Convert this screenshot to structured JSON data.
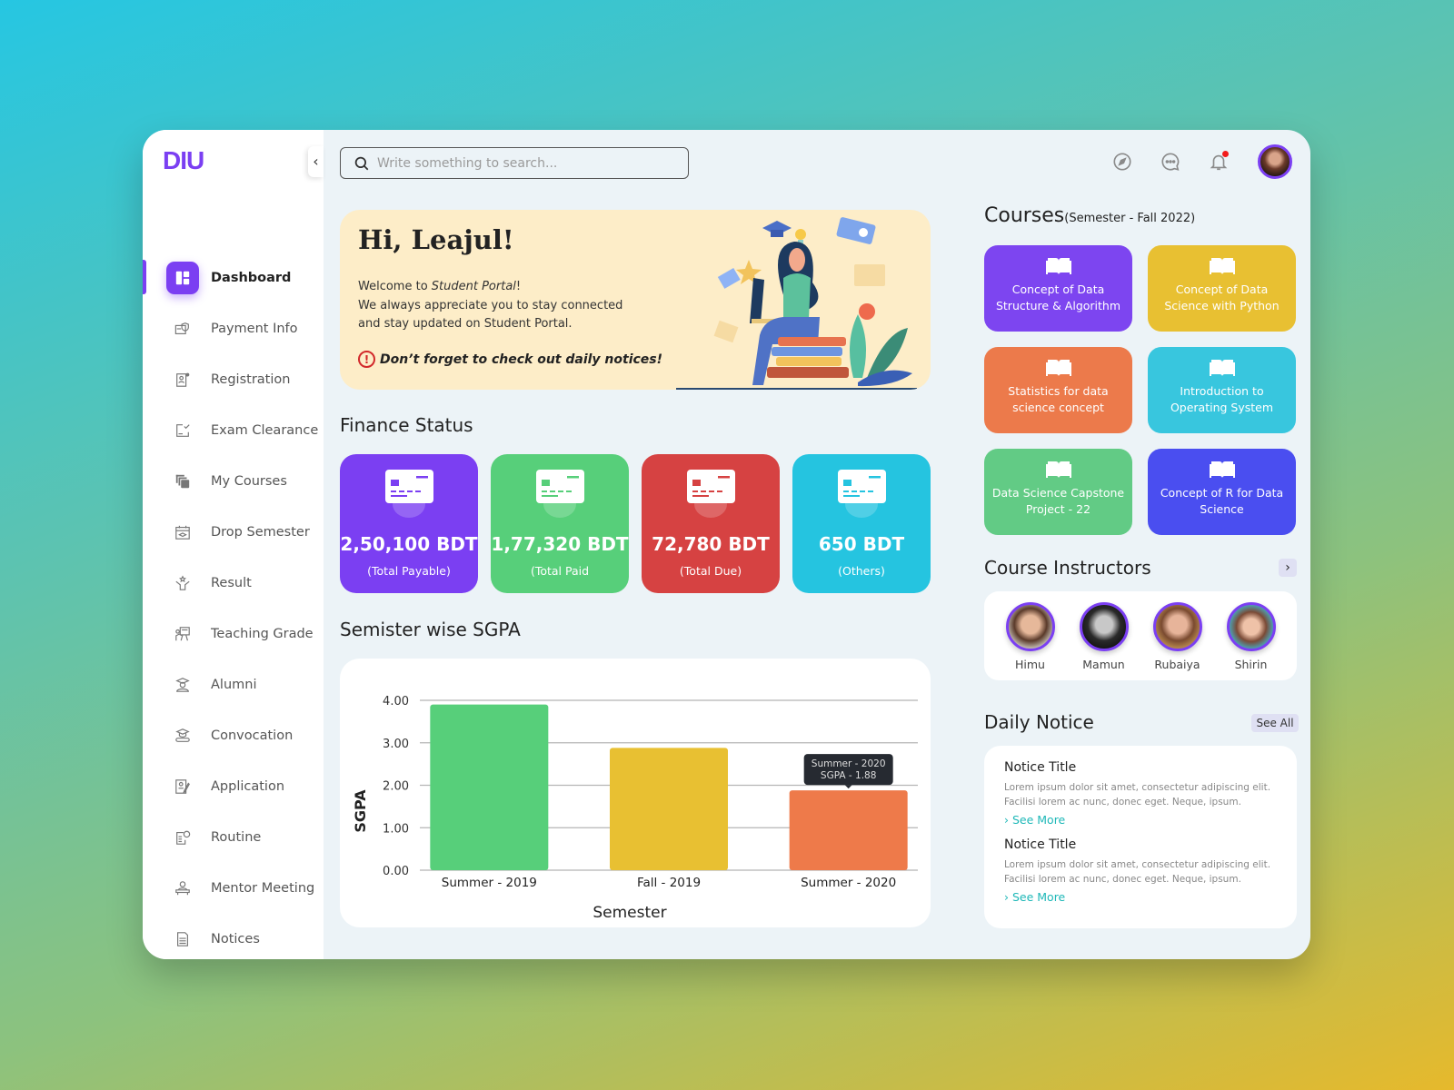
{
  "app": {
    "logo": "DIU",
    "collapse_icon": "‹"
  },
  "search": {
    "placeholder": "Write something to search..."
  },
  "topbar": {
    "icons": [
      "compass-icon",
      "chat-icon",
      "bell-icon"
    ],
    "has_notification": true
  },
  "sidebar": {
    "items": [
      {
        "label": "Dashboard",
        "icon": "dashboard-icon",
        "active": true
      },
      {
        "label": "Payment Info",
        "icon": "payment-icon"
      },
      {
        "label": "Registration",
        "icon": "registration-icon"
      },
      {
        "label": "Exam Clearance",
        "icon": "exam-clearance-icon"
      },
      {
        "label": "My Courses",
        "icon": "courses-icon"
      },
      {
        "label": "Drop Semester",
        "icon": "drop-semester-icon"
      },
      {
        "label": "Result",
        "icon": "result-icon"
      },
      {
        "label": "Teaching Grade",
        "icon": "teaching-grade-icon"
      },
      {
        "label": "Alumni",
        "icon": "alumni-icon"
      },
      {
        "label": "Convocation",
        "icon": "convocation-icon"
      },
      {
        "label": "Application",
        "icon": "application-icon"
      },
      {
        "label": "Routine",
        "icon": "routine-icon"
      },
      {
        "label": "Mentor Meeting",
        "icon": "mentor-meeting-icon"
      },
      {
        "label": "Notices",
        "icon": "notices-icon"
      }
    ]
  },
  "hero": {
    "greeting": "Hi, Leajul!",
    "line1_prefix": "Welcome to ",
    "line1_em": "Student Portal",
    "line1_suffix": "!",
    "line2": "We always appreciate you to stay connected",
    "line3": "and stay updated on Student Portal.",
    "warning_icon": "!",
    "warning": "Don’t forget to check out daily notices!"
  },
  "finance": {
    "title": "Finance Status",
    "cards": [
      {
        "amount": "2,50,100 BDT",
        "label": "(Total Payable)",
        "color": "#7b3ff2"
      },
      {
        "amount": "1,77,320 BDT",
        "label": "(Total Paid",
        "color": "#57cf7a"
      },
      {
        "amount": "72,780 BDT",
        "label": "(Total Due)",
        "color": "#d64242"
      },
      {
        "amount": "650 BDT",
        "label": "(Others)",
        "color": "#25c4e0"
      }
    ]
  },
  "sgpa": {
    "title": "Semister wise SGPA"
  },
  "chart_data": {
    "type": "bar",
    "title": "Semister wise SGPA",
    "xlabel": "Semester",
    "ylabel": "SGPA",
    "categories": [
      "Summer - 2019",
      "Fall - 2019",
      "Summer - 2020"
    ],
    "values": [
      3.9,
      2.88,
      1.88
    ],
    "colors": [
      "#57cf7a",
      "#e8c032",
      "#ee7a4a"
    ],
    "ylim": [
      0,
      4
    ],
    "yticks": [
      "0.00",
      "1.00",
      "2.00",
      "3.00",
      "4.00"
    ],
    "grid": true,
    "tooltip": {
      "line1": "Summer - 2020",
      "line2": "SGPA - 1.88",
      "index": 2
    }
  },
  "courses": {
    "title": "Courses",
    "subtitle": "(Semester - Fall 2022)",
    "items": [
      {
        "name": "Concept of Data Structure & Algorithm",
        "color": "#7d45f0"
      },
      {
        "name": "Concept of Data Science with Python",
        "color": "#e8c032"
      },
      {
        "name": "Statistics for data science concept",
        "color": "#ec7a4b"
      },
      {
        "name": "Introduction to Operating System",
        "color": "#38c6de"
      },
      {
        "name": "Data Science Capstone Project - 22",
        "color": "#62cb85"
      },
      {
        "name": "Concept of R for Data Science",
        "color": "#4a4ef0"
      }
    ]
  },
  "instructors": {
    "title": "Course Instructors",
    "next_icon": "›",
    "items": [
      {
        "name": "Himu"
      },
      {
        "name": "Mamun"
      },
      {
        "name": "Rubaiya"
      },
      {
        "name": "Shirin"
      }
    ]
  },
  "notices": {
    "title": "Daily Notice",
    "see_all": "See All",
    "items": [
      {
        "title": "Notice Title",
        "body": "Lorem ipsum dolor sit amet, consectetur adipiscing elit. Facilisi lorem ac nunc, donec eget. Neque, ipsum.",
        "more": "› See More"
      },
      {
        "title": "Notice Title",
        "body": "Lorem ipsum dolor sit amet, consectetur adipiscing elit. Facilisi lorem ac nunc, donec eget. Neque, ipsum.",
        "more": "› See More"
      }
    ]
  }
}
